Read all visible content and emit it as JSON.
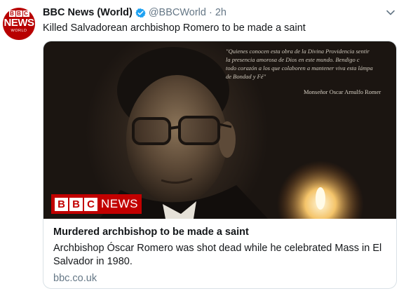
{
  "avatar": {
    "logo_letters": [
      "B",
      "B",
      "C"
    ],
    "news": "NEWS",
    "world": "WORLD"
  },
  "tweet": {
    "display_name": "BBC News (World)",
    "handle": "@BBCWorld",
    "separator": "·",
    "time": "2h",
    "text": "Killed Salvadorean archbishop Romero to be made a saint"
  },
  "card": {
    "quote": "\"Quienes conocen esta obra de la Divina Providencia sentir\nla presencia amorosa de Dios en este mundo. Bendigo c\ntodo corazón a los que colaboren a mantener viva esta lámpa\nde Bondad y Fé\"",
    "quote_author": "Monseñor Oscar Arnulfo Romer",
    "badge_letters": [
      "B",
      "B",
      "C"
    ],
    "badge_news": "NEWS",
    "title": "Murdered archbishop to be made a saint",
    "description": "Archbishop Óscar Romero was shot dead while he celebrated Mass in El Salvador in 1980.",
    "domain": "bbc.co.uk"
  },
  "colors": {
    "bbc_red": "#b80000",
    "verified_blue": "#1da1f2",
    "secondary_text": "#657786"
  },
  "icons": [
    "verified-badge-icon",
    "chevron-down-icon"
  ]
}
